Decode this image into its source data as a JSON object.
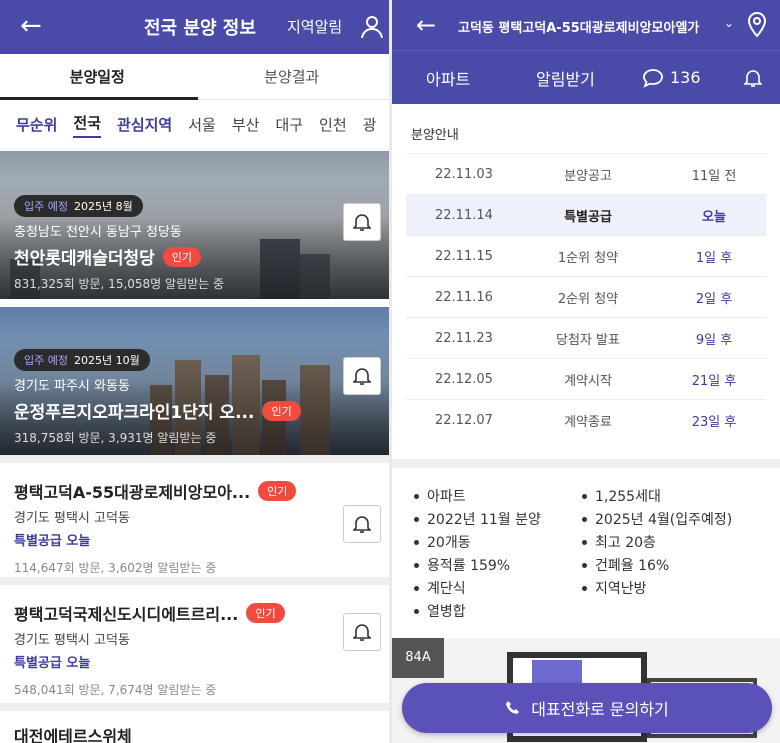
{
  "left": {
    "header": {
      "title": "전국 분양 정보",
      "region_alert": "지역알림"
    },
    "tabs": [
      "분양일정",
      "분양결과"
    ],
    "regions": [
      "무순위",
      "전국",
      "관심지역",
      "서울",
      "부산",
      "대구",
      "인천",
      "광"
    ],
    "cards_image": [
      {
        "status": "입주 예정",
        "date": "2025년 8월",
        "address": "충청남도 천안시 동남구 청당동",
        "name": "천안롯데캐슬더청당",
        "hot": "인기",
        "stats": "831,325회 방문, 15,058명 알림받는 중"
      },
      {
        "status": "입주 예정",
        "date": "2025년 10월",
        "address": "경기도 파주시 와동동",
        "name": "운정푸르지오파크라인1단지 오...",
        "hot": "인기",
        "stats": "318,758회 방문, 3,931명 알림받는 중"
      }
    ],
    "cards_plain": [
      {
        "name": "평택고덕A-55대광로제비앙모아...",
        "hot": "인기",
        "address": "경기도 평택시 고덕동",
        "supply": "특별공급 오늘",
        "stats": "114,647회 방문, 3,602명 알림받는 중"
      },
      {
        "name": "평택고덕국제신도시디에트르리...",
        "hot": "인기",
        "address": "경기도 평택시 고덕동",
        "supply": "특별공급 오늘",
        "stats": "548,041회 방문, 7,674명 알림받는 중"
      }
    ],
    "cut_card_title": "대전에테르스위체"
  },
  "right": {
    "header": {
      "title": "고덕동 평택고덕A-55대광로제비앙모아엘가"
    },
    "nav": {
      "apt": "아파트",
      "alarm": "알림받기",
      "comments": "136"
    },
    "section_title": "분양안내",
    "schedule": [
      {
        "date": "22.11.03",
        "event": "분양공고",
        "rel": "11일 전"
      },
      {
        "date": "22.11.14",
        "event": "특별공급",
        "rel": "오늘"
      },
      {
        "date": "22.11.15",
        "event": "1순위 청약",
        "rel": "1일 후"
      },
      {
        "date": "22.11.16",
        "event": "2순위 청약",
        "rel": "2일 후"
      },
      {
        "date": "22.11.23",
        "event": "당첨자 발표",
        "rel": "9일 후"
      },
      {
        "date": "22.12.05",
        "event": "계약시작",
        "rel": "21일 후"
      },
      {
        "date": "22.12.07",
        "event": "계약종료",
        "rel": "23일 후"
      }
    ],
    "specs": [
      "아파트",
      "1,255세대",
      "2022년 11월 분양",
      "2025년 4월(입주예정)",
      "20개동",
      "최고 20층",
      "용적률 159%",
      "건폐율 16%",
      "계단식",
      "지역난방",
      "열병합"
    ],
    "plan_tag": "84A",
    "call_button": "대표전화로 문의하기"
  }
}
